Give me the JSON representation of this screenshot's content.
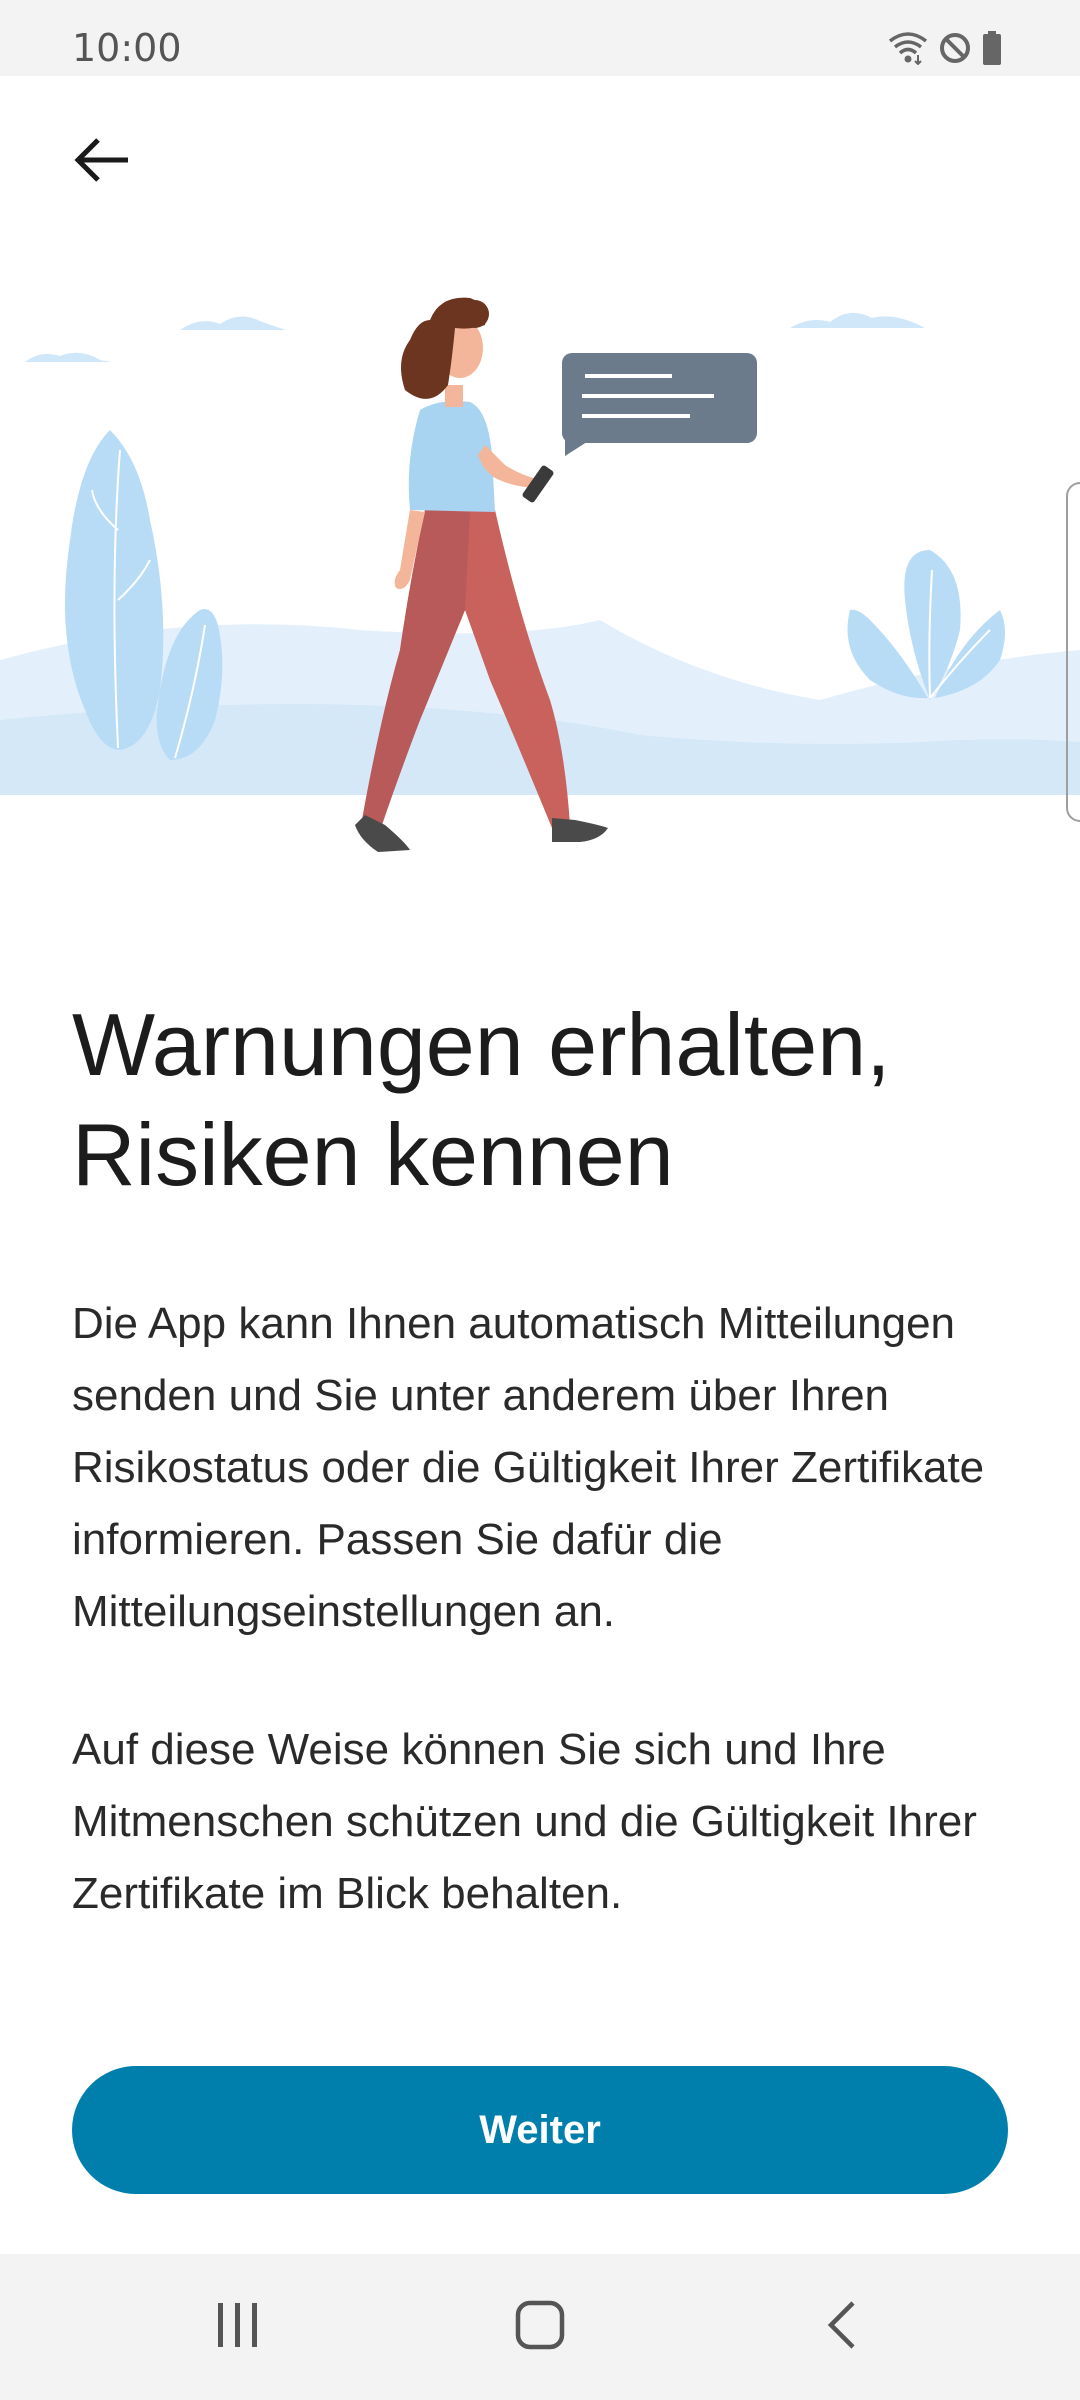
{
  "status_bar": {
    "time": "10:00",
    "icons": [
      "wifi-icon",
      "do-not-disturb-icon",
      "battery-icon"
    ]
  },
  "header": {
    "back_icon": "arrow-left-icon"
  },
  "illustration": {
    "description_icon": "woman-walking-with-phone-illustration"
  },
  "content": {
    "title": "Warnungen erhalten, Risiken kennen",
    "paragraph_1": "Die App kann Ihnen automatisch Mitteilungen senden und Sie unter anderem über Ihren Risikostatus oder die Gültigkeit Ihrer Zertifikate informieren. Passen Sie dafür die Mitteilungseinstellungen an.",
    "paragraph_2": "Auf diese Weise können Sie sich und Ihre Mitmenschen schützen und die Gültigkeit Ihrer Zertifikate im Blick behalten."
  },
  "actions": {
    "continue_label": "Weiter"
  },
  "nav_bar": {
    "icons": [
      "recents-icon",
      "home-icon",
      "back-icon"
    ]
  },
  "colors": {
    "accent": "#007fad",
    "illustration_light_blue": "#bfe0f7",
    "bubble": "#6b7b8b"
  }
}
